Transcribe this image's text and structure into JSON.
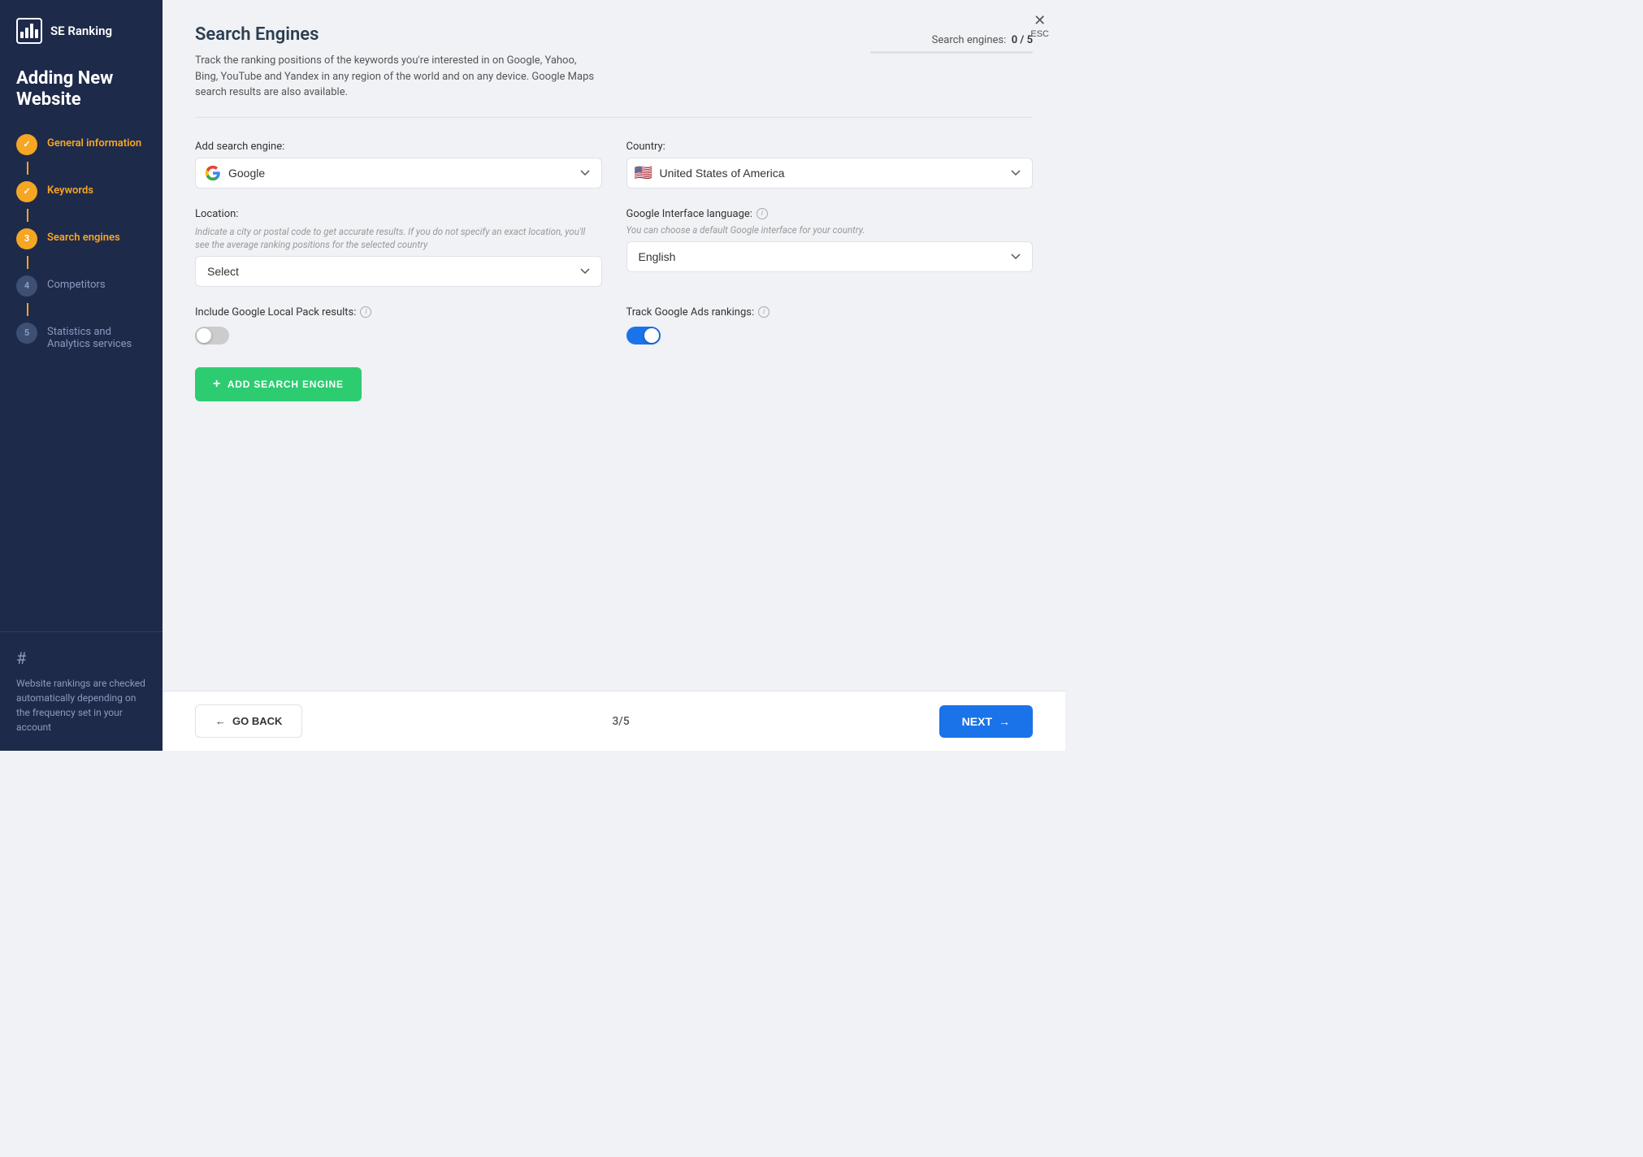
{
  "app": {
    "logo_text": "SE Ranking",
    "heading": "Adding New Website"
  },
  "sidebar": {
    "steps": [
      {
        "number": "✓",
        "label": "General information",
        "active": true
      },
      {
        "number": "✓",
        "label": "Keywords",
        "active": true
      },
      {
        "number": "3",
        "label": "Search engines",
        "active": true
      },
      {
        "number": "4",
        "label": "Competitors",
        "active": false
      },
      {
        "number": "5",
        "label": "Statistics and Analytics services",
        "active": false
      }
    ],
    "bottom_note": "Website rankings are checked automatically depending on the frequency set in your account",
    "hash": "#"
  },
  "close_button": {
    "label": "ESC"
  },
  "main": {
    "title": "Search Engines",
    "description": "Track the ranking positions of the keywords you're interested in on Google, Yahoo, Bing, YouTube and Yandex in any region of the world and on any device. Google Maps search results are also available.",
    "search_engines_label": "Search engines:",
    "search_engines_count": "0 / 5",
    "add_engine_label": "Add search engine:",
    "add_engine_value": "Google",
    "country_label": "Country:",
    "country_value": "United States of America",
    "location_label": "Location:",
    "location_sub": "Indicate a city or postal code to get accurate results. If you do not specify an exact location, you'll see the average ranking positions for the selected country",
    "location_placeholder": "Select",
    "language_label": "Google Interface language:",
    "language_info": "i",
    "language_sub": "You can choose a default Google interface for your country.",
    "language_value": "English",
    "local_pack_label": "Include Google Local Pack results:",
    "local_pack_info": "i",
    "local_pack_on": false,
    "google_ads_label": "Track Google Ads rankings:",
    "google_ads_info": "i",
    "google_ads_on": true,
    "add_button": "+ ADD SEARCH ENGINE"
  },
  "footer": {
    "go_back": "GO BACK",
    "page": "3/5",
    "next": "NEXT"
  }
}
